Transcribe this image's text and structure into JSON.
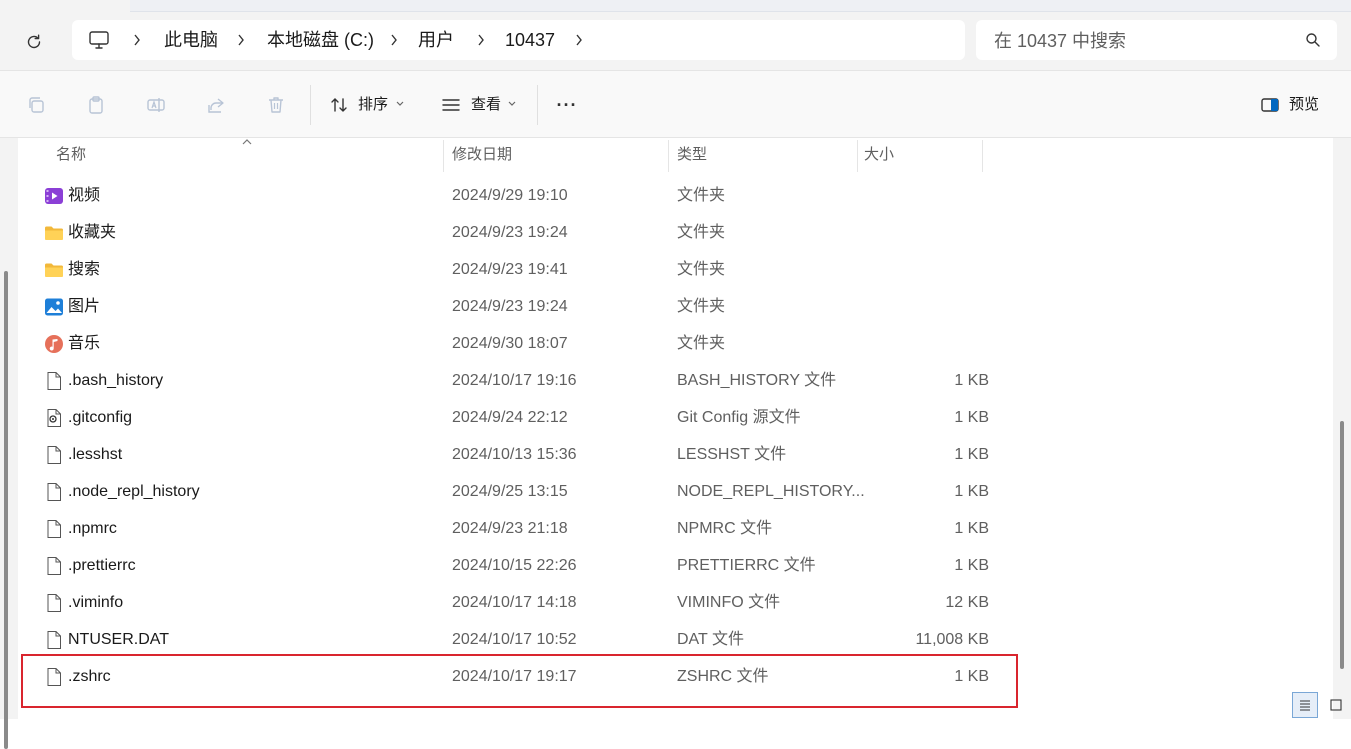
{
  "breadcrumb": {
    "items": [
      "此电脑",
      "本地磁盘 (C:)",
      "用户",
      "10437"
    ]
  },
  "search": {
    "placeholder": "在 10437 中搜索"
  },
  "toolbar": {
    "sort_label": "排序",
    "view_label": "查看",
    "more_label": "···",
    "preview_label": "预览"
  },
  "columns": {
    "name": "名称",
    "date": "修改日期",
    "type": "类型",
    "size": "大小"
  },
  "files": [
    {
      "icon": "video-folder-icon",
      "name": "视频",
      "date": "2024/9/29 19:10",
      "type": "文件夹",
      "size": ""
    },
    {
      "icon": "folder-icon",
      "name": "收藏夹",
      "date": "2024/9/23 19:24",
      "type": "文件夹",
      "size": ""
    },
    {
      "icon": "folder-icon",
      "name": "搜索",
      "date": "2024/9/23 19:41",
      "type": "文件夹",
      "size": ""
    },
    {
      "icon": "pictures-folder-icon",
      "name": "图片",
      "date": "2024/9/23 19:24",
      "type": "文件夹",
      "size": ""
    },
    {
      "icon": "music-folder-icon",
      "name": "音乐",
      "date": "2024/9/30 18:07",
      "type": "文件夹",
      "size": ""
    },
    {
      "icon": "file-icon",
      "name": ".bash_history",
      "date": "2024/10/17 19:16",
      "type": "BASH_HISTORY 文件",
      "size": "1 KB"
    },
    {
      "icon": "config-file-icon",
      "name": ".gitconfig",
      "date": "2024/9/24 22:12",
      "type": "Git Config 源文件",
      "size": "1 KB"
    },
    {
      "icon": "file-icon",
      "name": ".lesshst",
      "date": "2024/10/13 15:36",
      "type": "LESSHST 文件",
      "size": "1 KB"
    },
    {
      "icon": "file-icon",
      "name": ".node_repl_history",
      "date": "2024/9/25 13:15",
      "type": "NODE_REPL_HISTORY...",
      "size": "1 KB"
    },
    {
      "icon": "file-icon",
      "name": ".npmrc",
      "date": "2024/9/23 21:18",
      "type": "NPMRC 文件",
      "size": "1 KB"
    },
    {
      "icon": "file-icon",
      "name": ".prettierrc",
      "date": "2024/10/15 22:26",
      "type": "PRETTIERRC 文件",
      "size": "1 KB"
    },
    {
      "icon": "file-icon",
      "name": ".viminfo",
      "date": "2024/10/17 14:18",
      "type": "VIMINFO 文件",
      "size": "12 KB"
    },
    {
      "icon": "file-icon",
      "name": "NTUSER.DAT",
      "date": "2024/10/17 10:52",
      "type": "DAT 文件",
      "size": "11,008 KB"
    },
    {
      "icon": "file-icon",
      "name": ".zshrc",
      "date": "2024/10/17 19:17",
      "type": "ZSHRC 文件",
      "size": "1 KB"
    }
  ],
  "colors": {
    "highlight_border": "#d9252e",
    "accent": "#0067c0"
  }
}
